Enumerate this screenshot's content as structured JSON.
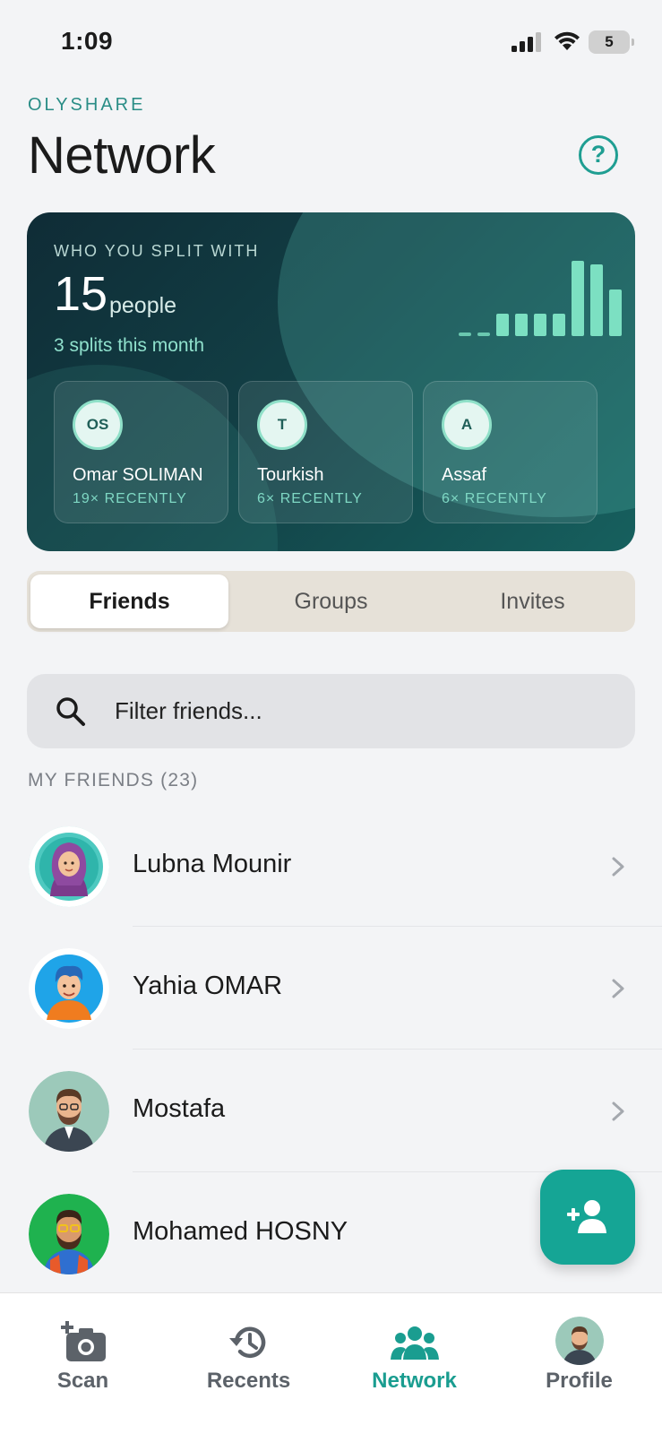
{
  "status_bar": {
    "time": "1:09",
    "battery": "5"
  },
  "header": {
    "brand": "OLYSHARE",
    "title": "Network",
    "help_icon": "question-circle-icon"
  },
  "hero": {
    "label": "WHO YOU SPLIT WITH",
    "count": "15",
    "unit": "people",
    "subtitle": "3 splits this month",
    "bars": [
      0.05,
      0.05,
      0.3,
      0.3,
      0.3,
      0.3,
      1.0,
      0.95,
      0.62
    ],
    "top_people": [
      {
        "initials": "OS",
        "name": "Omar SOLIMAN",
        "count": "19× RECENTLY"
      },
      {
        "initials": "T",
        "name": "Tourkish",
        "count": "6× RECENTLY"
      },
      {
        "initials": "A",
        "name": "Assaf",
        "count": "6× RECENTLY"
      }
    ]
  },
  "segments": {
    "friends": "Friends",
    "groups": "Groups",
    "invites": "Invites",
    "selected": "Friends"
  },
  "search": {
    "placeholder": "Filter friends..."
  },
  "section": {
    "label": "MY FRIENDS (23)"
  },
  "friends": [
    {
      "name": "Lubna Mounir"
    },
    {
      "name": "Yahia OMAR"
    },
    {
      "name": "Mostafa"
    },
    {
      "name": "Mohamed HOSNY"
    }
  ],
  "tabbar": {
    "scan": "Scan",
    "recents": "Recents",
    "network": "Network",
    "profile": "Profile",
    "active": "Network"
  },
  "colors": {
    "accent": "#1a9d90",
    "hero_bg": "#123f45",
    "bar": "#7ce0c2"
  }
}
